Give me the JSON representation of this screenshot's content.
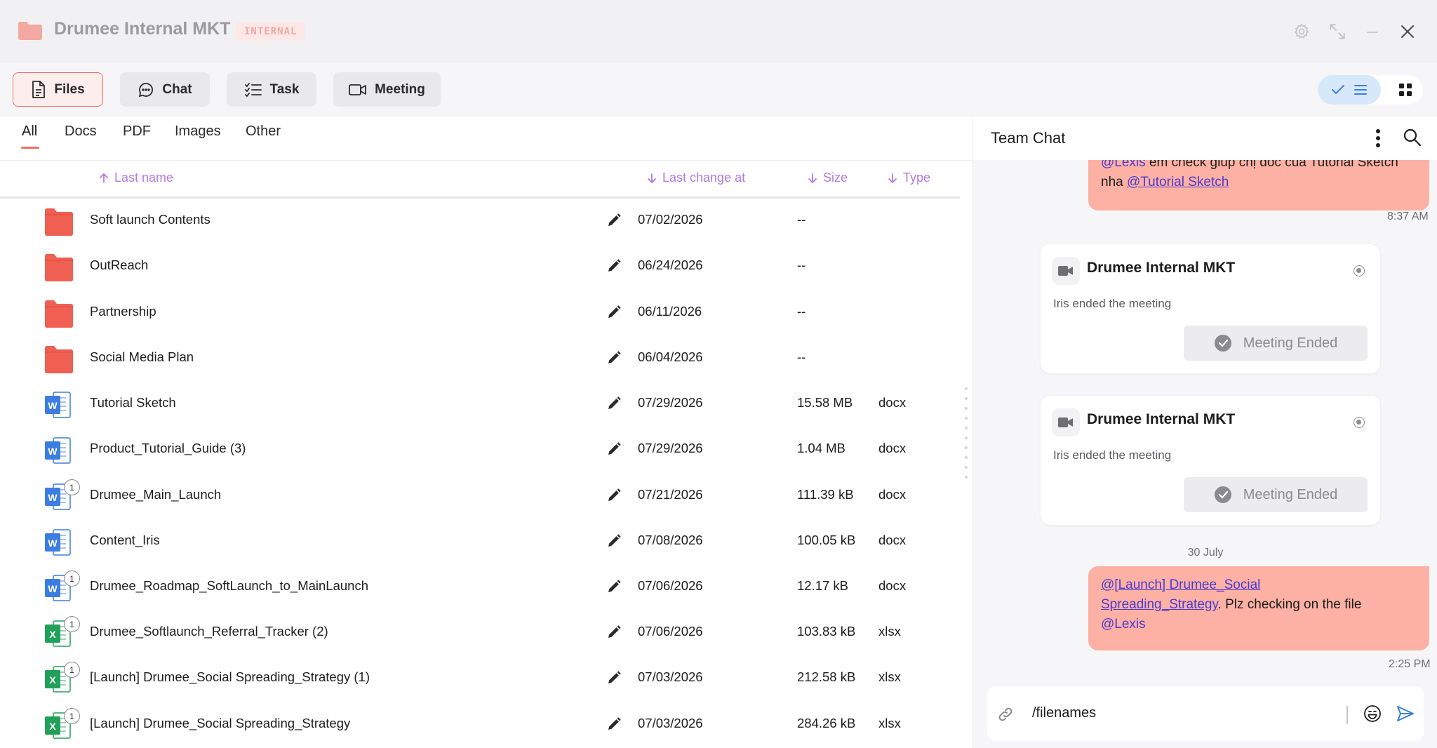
{
  "app": {
    "title": "Drumee Internal MKT",
    "badge": "INTERNAL"
  },
  "main_tabs": [
    {
      "label": "Files",
      "icon": "document-icon",
      "active": true
    },
    {
      "label": "Chat",
      "icon": "chat-bubble-icon",
      "active": false
    },
    {
      "label": "Task",
      "icon": "checklist-icon",
      "active": false
    },
    {
      "label": "Meeting",
      "icon": "video-camera-icon",
      "active": false
    }
  ],
  "filter_tabs": [
    "All",
    "Docs",
    "PDF",
    "Images",
    "Other"
  ],
  "columns": {
    "name": "Last name",
    "changed": "Last change at",
    "size": "Size",
    "type": "Type"
  },
  "files": [
    {
      "name": "Soft launch Contents",
      "date": "07/02/2026",
      "size": "--",
      "type": "",
      "kind": "folder",
      "version": ""
    },
    {
      "name": "OutReach",
      "date": "06/24/2026",
      "size": "--",
      "type": "",
      "kind": "folder",
      "version": ""
    },
    {
      "name": "Partnership",
      "date": "06/11/2026",
      "size": "--",
      "type": "",
      "kind": "folder",
      "version": ""
    },
    {
      "name": "Social Media Plan",
      "date": "06/04/2026",
      "size": "--",
      "type": "",
      "kind": "folder",
      "version": ""
    },
    {
      "name": "Tutorial Sketch",
      "date": "07/29/2026",
      "size": "15.58 MB",
      "type": "docx",
      "kind": "word",
      "version": ""
    },
    {
      "name": "Product_Tutorial_Guide (3)",
      "date": "07/29/2026",
      "size": "1.04 MB",
      "type": "docx",
      "kind": "word",
      "version": ""
    },
    {
      "name": "Drumee_Main_Launch",
      "date": "07/21/2026",
      "size": "111.39 kB",
      "type": "docx",
      "kind": "word",
      "version": "1"
    },
    {
      "name": "Content_Iris",
      "date": "07/08/2026",
      "size": "100.05 kB",
      "type": "docx",
      "kind": "word",
      "version": ""
    },
    {
      "name": "Drumee_Roadmap_SoftLaunch_to_MainLaunch",
      "date": "07/06/2026",
      "size": "12.17 kB",
      "type": "docx",
      "kind": "word",
      "version": "1"
    },
    {
      "name": "Drumee_Softlaunch_Referral_Tracker (2)",
      "date": "07/06/2026",
      "size": "103.83 kB",
      "type": "xlsx",
      "kind": "excel",
      "version": "1"
    },
    {
      "name": "[Launch] Drumee_Social Spreading_Strategy (1)",
      "date": "07/03/2026",
      "size": "212.58 kB",
      "type": "xlsx",
      "kind": "excel",
      "version": "1"
    },
    {
      "name": "[Launch] Drumee_Social Spreading_Strategy",
      "date": "07/03/2026",
      "size": "284.26 kB",
      "type": "xlsx",
      "kind": "excel",
      "version": "1"
    }
  ],
  "chat": {
    "title": "Team Chat",
    "msg1": {
      "mention": "@Lexis",
      "text": " em check giúp chị doc của Tutorial Sketch",
      "text2": "nha ",
      "link": "@Tutorial Sketch",
      "time": "8:37 AM"
    },
    "meetings": [
      {
        "title": "Drumee Internal MKT",
        "desc": "Iris ended the meeting",
        "status": "Meeting Ended"
      },
      {
        "title": "Drumee Internal MKT",
        "desc": "Iris ended the meeting",
        "status": "Meeting Ended"
      }
    ],
    "date_separator": "30 July",
    "msg2": {
      "link_line1": "@[Launch] Drumee_Social",
      "link_line2": "Spreading_Strategy",
      "text": ". Plz checking on the file",
      "mention": "@Lexis",
      "time": "2:25 PM"
    },
    "composer_value": "/filenames"
  },
  "colors": {
    "accent": "#ef6e62",
    "folder": "#ef5f52",
    "word": "#3b7de0",
    "excel": "#21a05a",
    "header_purple": "#b07ae6",
    "bubble": "#fdb1a4"
  }
}
